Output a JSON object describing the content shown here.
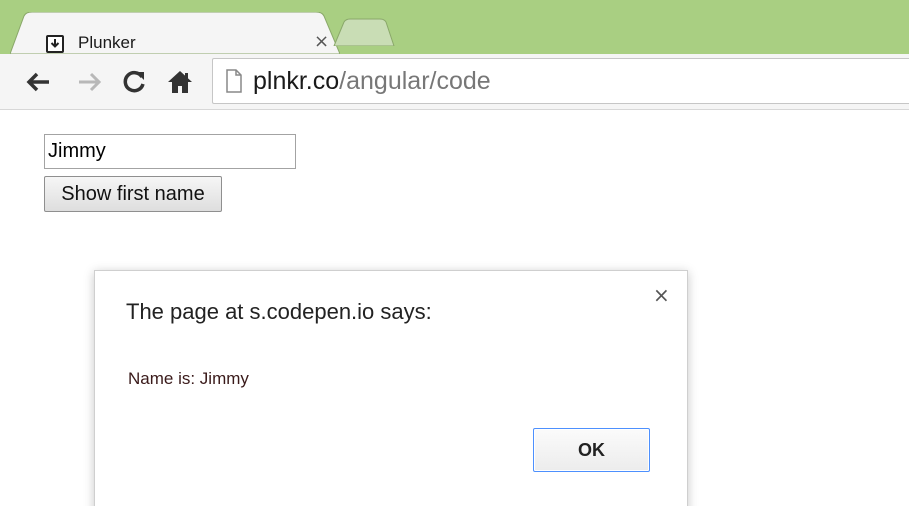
{
  "browser": {
    "tab": {
      "title": "Plunker",
      "close_glyph": "×",
      "favicon": "download-arrow-icon"
    },
    "toolbar": {
      "back_icon": "back-arrow-icon",
      "forward_icon": "forward-arrow-icon",
      "reload_icon": "reload-icon",
      "home_icon": "home-icon"
    },
    "address_bar": {
      "host": "plnkr.co",
      "path": "/angular/code",
      "page_icon": "page-icon"
    }
  },
  "page": {
    "name_input": {
      "value": "Jimmy"
    },
    "show_button": {
      "label": "Show first name"
    }
  },
  "dialog": {
    "title": "The page at s.codepen.io says:",
    "close_glyph": "×",
    "message": "Name is: Jimmy",
    "ok_label": "OK"
  },
  "colors": {
    "tabstrip": "#a9cf82",
    "toolbar": "#f5f5f5",
    "focus_border": "#4d90fe"
  }
}
